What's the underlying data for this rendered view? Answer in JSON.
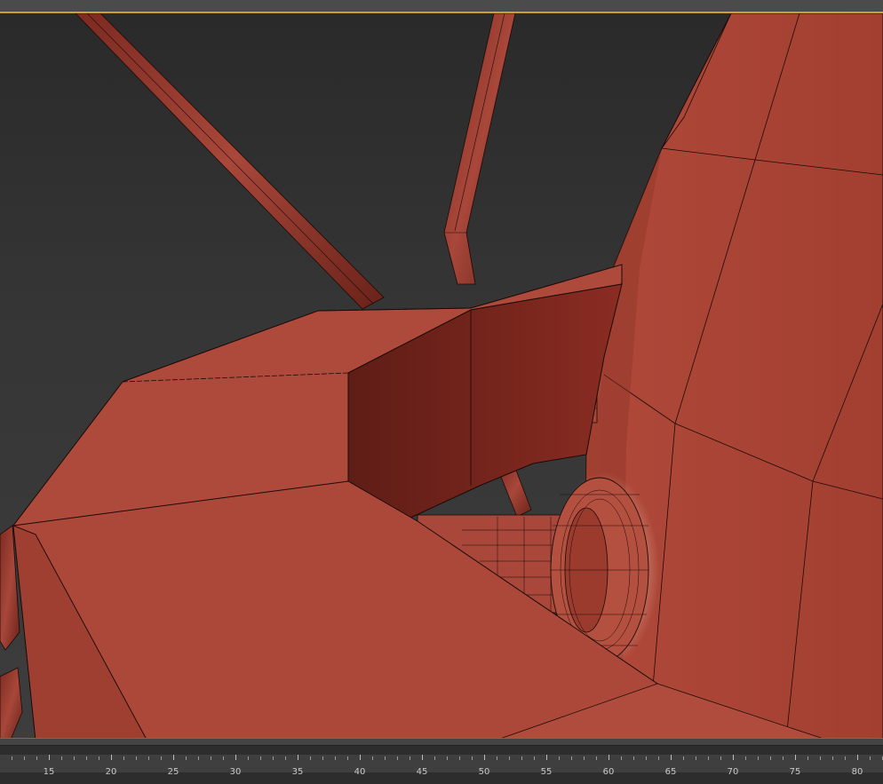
{
  "viewport": {
    "background": "#353535",
    "model_color": "#a84638",
    "model_shadow": "#7e2a20",
    "edge_color": "#1b0a07"
  },
  "timeline": {
    "labels": [
      "15",
      "20",
      "25",
      "30",
      "35",
      "40",
      "45",
      "50",
      "55",
      "60",
      "65",
      "70",
      "75",
      "80"
    ]
  }
}
